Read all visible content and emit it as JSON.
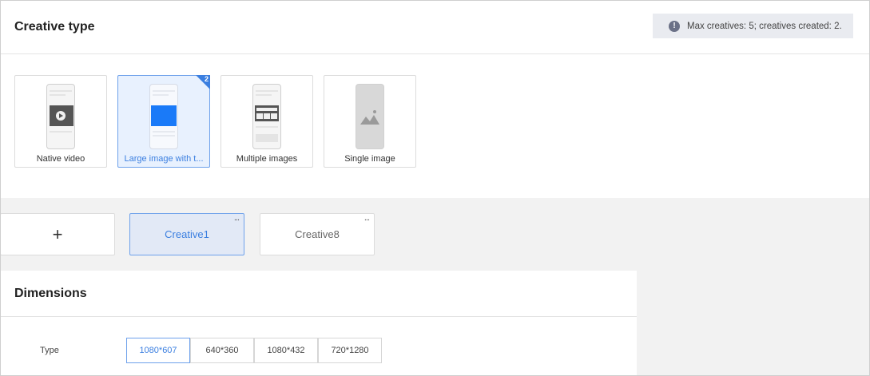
{
  "creative_type": {
    "title": "Creative type",
    "notice": {
      "icon": "info-icon",
      "text": "Max creatives: 5; creatives created: 2."
    },
    "cards": [
      {
        "label": "Native video",
        "icon": "native-video-icon",
        "selected": false
      },
      {
        "label": "Large image with t...",
        "icon": "large-image-icon",
        "selected": true,
        "count": "2"
      },
      {
        "label": "Multiple images",
        "icon": "multiple-images-icon",
        "selected": false
      },
      {
        "label": "Single image",
        "icon": "single-image-icon",
        "selected": false
      }
    ]
  },
  "creatives": {
    "add_label": "+",
    "tabs": [
      {
        "label": "Creative1",
        "active": true,
        "more": "..."
      },
      {
        "label": "Creative8",
        "active": false,
        "more": "..."
      }
    ]
  },
  "dimensions": {
    "title": "Dimensions",
    "type_label": "Type",
    "options": [
      {
        "label": "1080*607",
        "selected": true
      },
      {
        "label": "640*360",
        "selected": false
      },
      {
        "label": "1080*432",
        "selected": false
      },
      {
        "label": "720*1280",
        "selected": false
      }
    ]
  },
  "colors": {
    "accent": "#3b7fe0",
    "selected_bg": "#e8f1fe",
    "page_bg": "#f2f2f2"
  }
}
